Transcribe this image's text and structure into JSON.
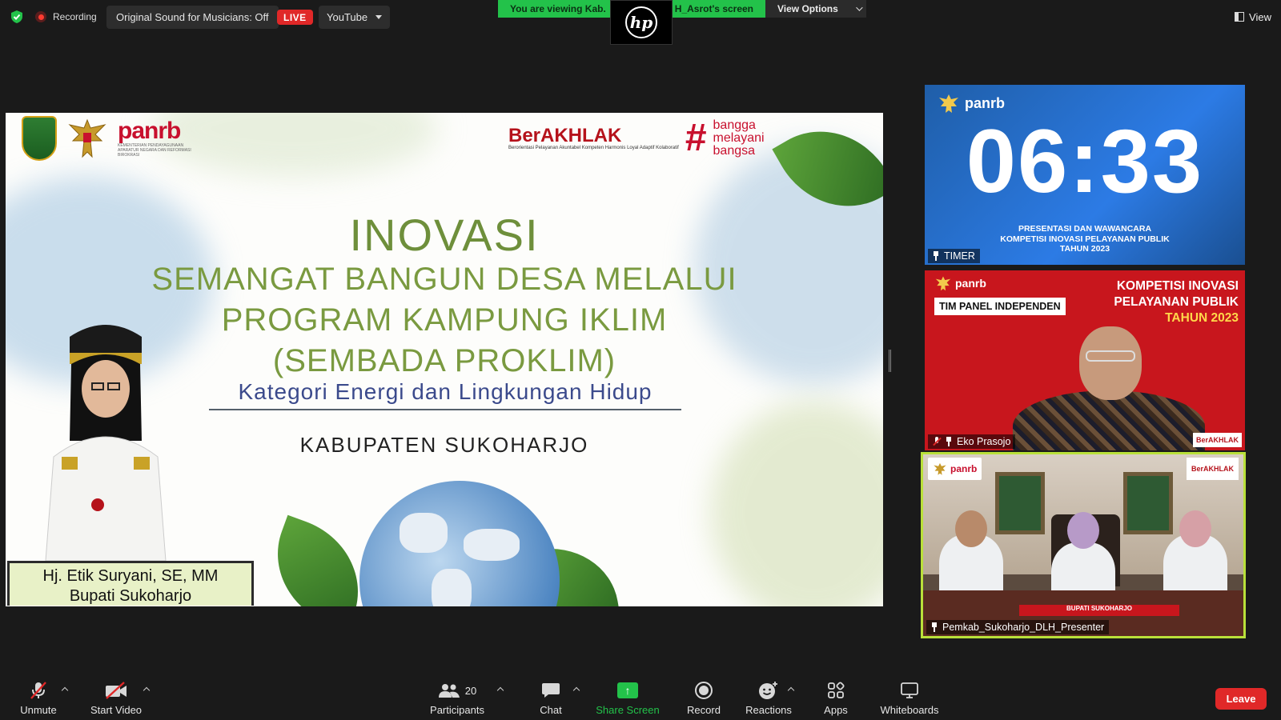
{
  "app": {
    "colors": {
      "accent_green": "#23c24a",
      "live_red": "#e02828",
      "toolbar_bg": "#1a1a1a"
    }
  },
  "topbar": {
    "recording_label": "Recording",
    "original_sound": "Original Sound for Musicians: Off",
    "live_badge": "LIVE",
    "stream_target": "YouTube",
    "viewing_banner": "You are viewing Kab.",
    "viewing_banner_tail": "H_Asrot's screen",
    "view_options": "View Options",
    "view_button": "View",
    "icons": [
      "shield-check-icon",
      "record-dot-icon",
      "chevron-down-icon",
      "view-layout-icon"
    ]
  },
  "slide": {
    "logo_panrb": "panrb",
    "logo_panrb_sub": "KEMENTERIAN PENDAYAGUNAAN APARATUR NEGARA DAN REFORMASI BIROKRASI",
    "berakhlak": "BerAKHLAK",
    "berakhlak_sub": "Berorientasi Pelayanan Akuntabel Kompeten Harmonis Loyal Adaptif Kolaboratif",
    "bangga_hash": "#",
    "bangga_line1": "bangga",
    "bangga_line2": "melayani",
    "bangga_line3": "bangsa",
    "title_line1": "INOVASI",
    "title_line2": "SEMANGAT BANGUN DESA MELALUI",
    "title_line3": "PROGRAM KAMPUNG IKLIM",
    "title_line4": "(SEMBADA PROKLIM)",
    "subtitle": "Kategori Energi dan Lingkungan Hidup",
    "region": "KABUPATEN SUKOHARJO",
    "person_name": "Hj. Etik Suryani, SE, MM",
    "person_title": "Bupati Sukoharjo"
  },
  "participants_tiles": {
    "timer": {
      "logo": "panrb",
      "time": "06:33",
      "caption_line1": "PRESENTASI DAN WAWANCARA",
      "caption_line2": "KOMPETISI INOVASI PELAYANAN PUBLIK",
      "caption_line3": "TAHUN 2023",
      "name": "TIMER"
    },
    "panel": {
      "logo": "panrb",
      "tag": "TIM PANEL INDEPENDEN",
      "heading_line1": "KOMPETISI INOVASI",
      "heading_line2": "PELAYANAN PUBLIK",
      "heading_line3": "TAHUN 2023",
      "corner_logo": "BerAKHLAK",
      "name": "Eko Prasojo"
    },
    "presenter": {
      "logo": "panrb",
      "corner_logo": "BerAKHLAK",
      "desk_banner": "BUPATI SUKOHARJO",
      "name": "Pemkab_Sukoharjo_DLH_Presenter"
    }
  },
  "toolbar": {
    "unmute": "Unmute",
    "start_video": "Start Video",
    "participants": "Participants",
    "participants_count": "20",
    "chat": "Chat",
    "share_screen": "Share Screen",
    "record": "Record",
    "reactions": "Reactions",
    "apps": "Apps",
    "whiteboards": "Whiteboards",
    "leave": "Leave"
  }
}
